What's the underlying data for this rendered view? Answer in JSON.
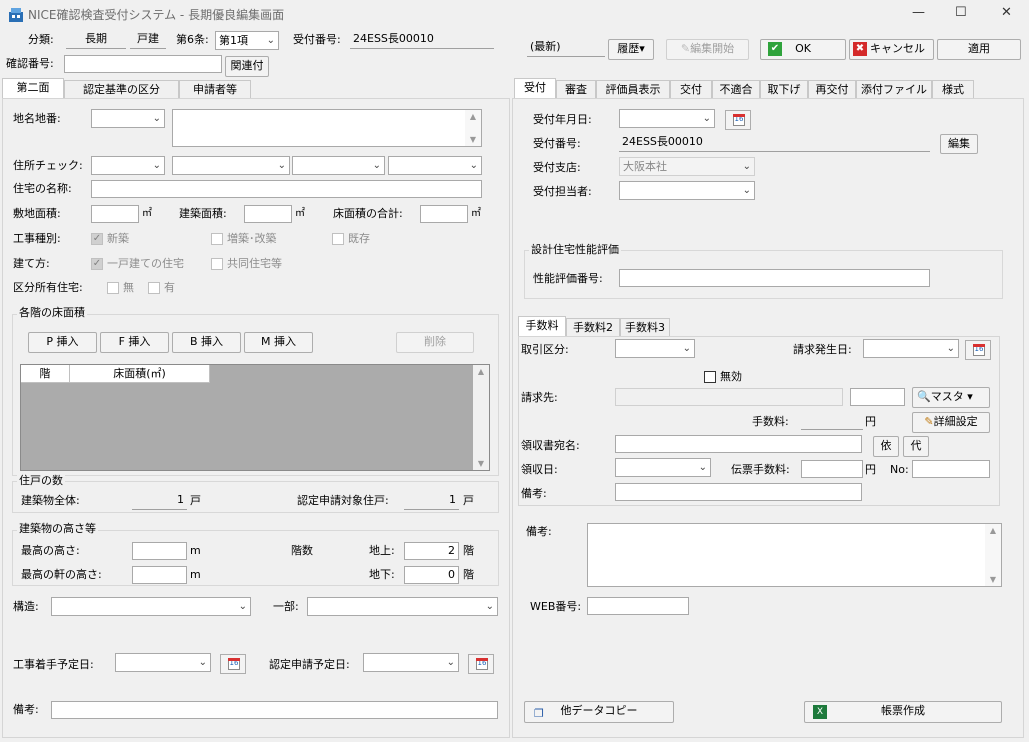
{
  "window": {
    "title": "NICE確認検査受付システム - 長期優良編集画面",
    "min": "—",
    "max": "☐",
    "close": "✕"
  },
  "top": {
    "bunrui_label": "分類:",
    "bunrui_val": "長期",
    "kodate": "戸建",
    "jo_label": "第6条:",
    "jo_val": "第1項",
    "uketsuke_label": "受付番号:",
    "uketsuke_val": "24ESS長00010",
    "kakunin_label": "確認番号:",
    "kanren_btn": "関連付",
    "saishin": "(最新)",
    "rireki": "履歴▾",
    "henshu_kaishi": "編集開始",
    "ok": "OK",
    "cancel": "キャンセル",
    "apply": "適用"
  },
  "left_tabs": [
    "第二面",
    "認定基準の区分",
    "申請者等"
  ],
  "left": {
    "chimei_label": "地名地番:",
    "jusho_label": "住所チェック:",
    "jutaku_label": "住宅の名称:",
    "shikichi_label": "敷地面積:",
    "kenchiku_label": "建築面積:",
    "yuka_label": "床面積の合計:",
    "m2": "㎡",
    "koji_label": "工事種別:",
    "shinchiku": "新築",
    "zochiku": "増築･改築",
    "kison": "既存",
    "tatekata_label": "建て方:",
    "ikko": "一戸建ての住宅",
    "kyodo": "共同住宅等",
    "kubun_label": "区分所有住宅:",
    "mu": "無",
    "yu": "有",
    "kaiyuka_title": "各階の床面積",
    "p_btn": "P 挿入",
    "f_btn": "F 挿入",
    "b_btn": "B 挿入",
    "m_btn": "M 挿入",
    "del_btn": "削除",
    "col_kai": "階",
    "col_yuka": "床面積(㎡)",
    "jukosu_title": "住戸の数",
    "zentai_label": "建築物全体:",
    "zentai_val": "1",
    "ko": "戸",
    "nintei_label": "認定申請対象住戸:",
    "nintei_val": "1",
    "takasa_title": "建築物の高さ等",
    "saiko_label": "最高の高さ:",
    "noki_label": "最高の軒の高さ:",
    "m": "m",
    "kaisu_label": "階数",
    "chijo_label": "地上:",
    "chijo_val": "2",
    "chika_label": "地下:",
    "chika_val": "0",
    "kai": "階",
    "kozo_label": "構造:",
    "ichibu_label": "一部:",
    "chakushu_label": "工事着手予定日:",
    "shinsei_label": "認定申請予定日:",
    "biko_label": "備考:"
  },
  "right_tabs": [
    "受付",
    "審査",
    "評価員表示",
    "交付",
    "不適合",
    "取下げ",
    "再交付",
    "添付ファイル",
    "様式"
  ],
  "right": {
    "uke_date_label": "受付年月日:",
    "uke_no_label": "受付番号:",
    "uke_no_val": "24ESS長00010",
    "edit_btn": "編集",
    "shiten_label": "受付支店:",
    "shiten_val": "大阪本社",
    "tanto_label": "受付担当者:",
    "sekkei_title": "設計住宅性能評価",
    "seino_label": "性能評価番号:",
    "fee_tabs": [
      "手数料",
      "手数料2",
      "手数料3"
    ],
    "torihiki_label": "取引区分:",
    "seikyu_date_label": "請求発生日:",
    "muko": "無効",
    "seikyusaki_label": "請求先:",
    "master_btn": "マスタ ▾",
    "tesuryo_label": "手数料:",
    "yen": "円",
    "shosai_btn": "詳細設定",
    "ryoshu_label": "領収書宛名:",
    "i_btn": "依",
    "dai_btn": "代",
    "ryoshu_date_label": "領収日:",
    "denpyo_label": "伝票手数料:",
    "no_label": "No:",
    "biko_label": "備考:",
    "biko2_label": "備考:",
    "web_label": "WEB番号:",
    "copy_btn": "他データコピー",
    "chohyo_btn": "帳票作成"
  }
}
